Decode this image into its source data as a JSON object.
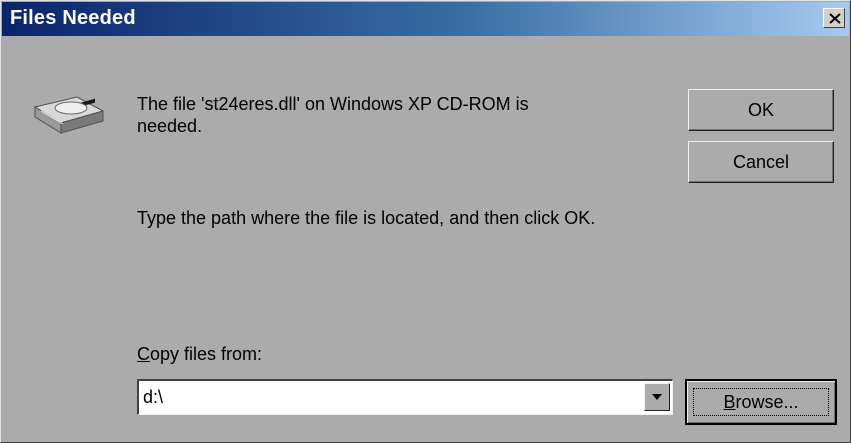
{
  "window": {
    "title": "Files Needed"
  },
  "message": {
    "line1": "The file 'st24eres.dll' on Windows XP CD-ROM is needed.",
    "line2": "Type the path where the file is located, and then click OK."
  },
  "buttons": {
    "ok": "OK",
    "cancel": "Cancel",
    "browse_accel": "B",
    "browse_rest": "rowse..."
  },
  "copy_from": {
    "label_accel": "C",
    "label_rest": "opy files from:",
    "value": "d:\\"
  },
  "icons": {
    "drive": "cd-drive-icon",
    "close": "close-icon",
    "dropdown": "chevron-down-icon"
  },
  "colors": {
    "dialog_bg": "#ababab",
    "titlebar_start": "#0a246a",
    "titlebar_end": "#a6caf0",
    "title_text": "#ffffff"
  }
}
